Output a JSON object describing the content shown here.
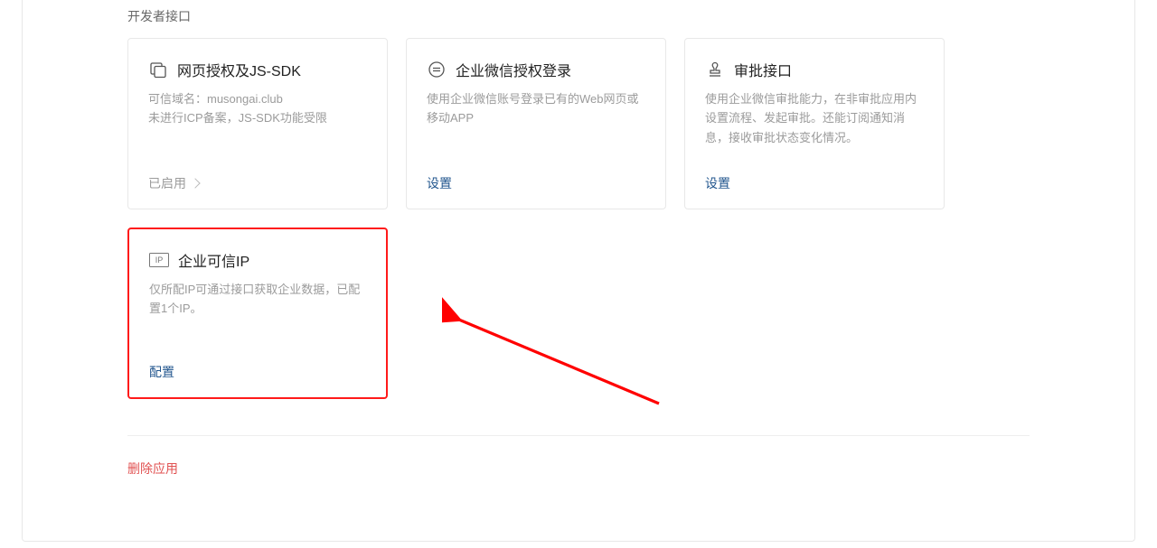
{
  "section_title": "开发者接口",
  "cards": [
    {
      "title": "网页授权及JS-SDK",
      "desc": "可信域名：musongai.club\n未进行ICP备案，JS-SDK功能受限",
      "action_label": "已启用",
      "action_style": "muted_chevron",
      "icon": "web-icon"
    },
    {
      "title": "企业微信授权登录",
      "desc": "使用企业微信账号登录已有的Web网页或移动APP",
      "action_label": "设置",
      "action_style": "link",
      "icon": "circle-equals-icon"
    },
    {
      "title": "审批接口",
      "desc": "使用企业微信审批能力，在非审批应用内设置流程、发起审批。还能订阅通知消息，接收审批状态变化情况。",
      "action_label": "设置",
      "action_style": "link",
      "icon": "stamp-icon"
    },
    {
      "title": "企业可信IP",
      "desc": "仅所配IP可通过接口获取企业数据，已配置1个IP。",
      "action_label": "配置",
      "action_style": "link",
      "icon": "ip-icon",
      "highlight": true
    }
  ],
  "delete_label": "删除应用",
  "colors": {
    "link": "#22568e",
    "danger": "#e15252",
    "highlight_border": "#ff1a1a",
    "arrow": "#ff0000"
  }
}
